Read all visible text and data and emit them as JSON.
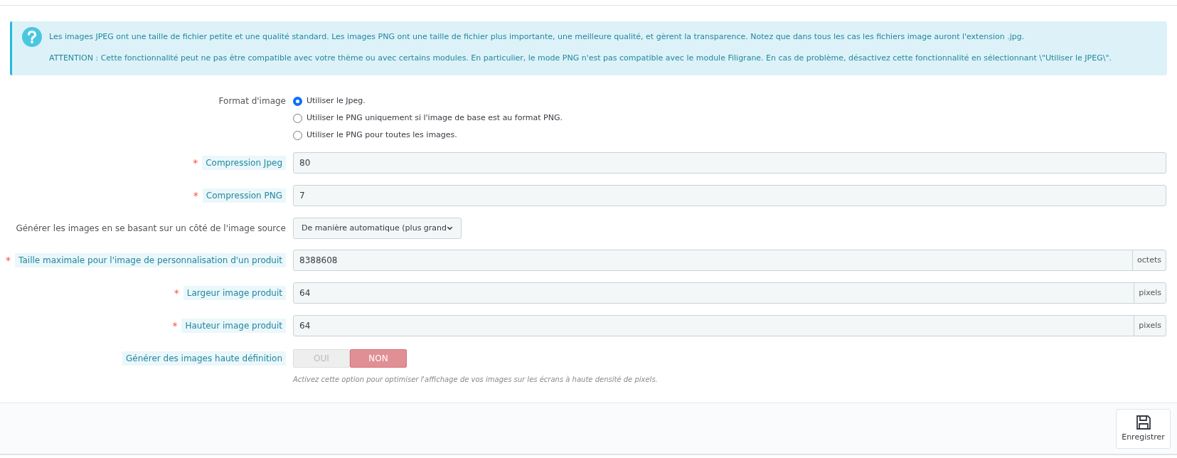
{
  "info": {
    "paragraphs": [
      "Les images JPEG ont une taille de fichier petite et une qualité standard. Les images PNG ont une taille de fichier plus importante, une meilleure qualité, et gèrent la transparence. Notez que dans tous les cas les fichiers image auront l'extension .jpg.",
      "ATTENTION : Cette fonctionnalité peut ne pas être compatible avec votre thème ou avec certains modules. En particulier, le mode PNG n'est pas compatible avec le module Filigrane. En cas de problème, désactivez cette fonctionnalité en sélectionnant \\\"Utiliser le JPEG\\\"."
    ]
  },
  "fields": [
    {
      "kind": "radio",
      "label": "Format d'image",
      "hint": false,
      "options": [
        {
          "label": "Utiliser le Jpeg.",
          "selected": true
        },
        {
          "label": "Utiliser le PNG uniquement si l'image de base est au format PNG.",
          "selected": false
        },
        {
          "label": "Utiliser le PNG pour toutes les images.",
          "selected": false
        }
      ]
    },
    {
      "kind": "text",
      "label": "Compression Jpeg",
      "required_mark": "*",
      "hint": true,
      "value": "80"
    },
    {
      "kind": "text",
      "label": "Compression PNG",
      "required_mark": "*",
      "hint": true,
      "value": "7"
    },
    {
      "kind": "select",
      "label": "Générer les images en se basant sur un côté de l'image source",
      "hint": false,
      "value": "De manière automatique (plus grand"
    },
    {
      "kind": "text",
      "label": "Taille maximale pour l'image de personnalisation d'un produit",
      "required_mark": "*",
      "hint": true,
      "value": "8388608",
      "suffix": "octets"
    },
    {
      "kind": "text",
      "label": "Largeur image produit",
      "required_mark": "*",
      "hint": true,
      "value": "64",
      "suffix": "pixels"
    },
    {
      "kind": "text",
      "label": "Hauteur image produit",
      "required_mark": "*",
      "hint": true,
      "value": "64",
      "suffix": "pixels"
    },
    {
      "kind": "switch",
      "label": "Générer des images haute définition",
      "hint": true,
      "on_label": "OUI",
      "off_label": "NON",
      "on": false,
      "help": "Activez cette option pour optimiser l'affichage de vos images sur les écrans à haute densité de pixels."
    }
  ],
  "save_button": "Enregistrer"
}
